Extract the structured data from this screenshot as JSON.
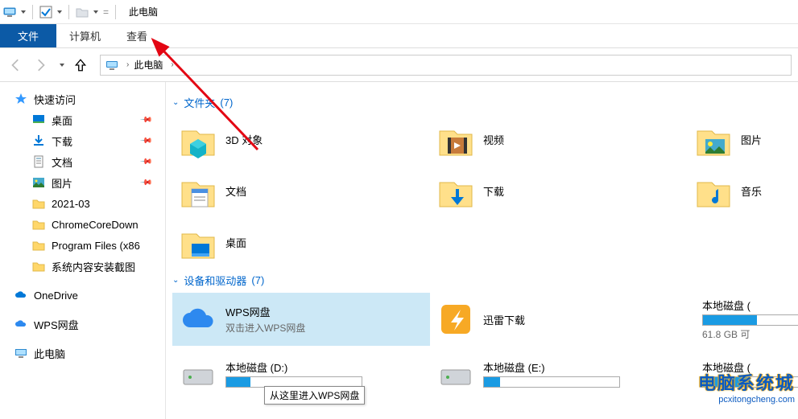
{
  "window_title": "此电脑",
  "ribbon": {
    "file": "文件",
    "computer": "计算机",
    "view": "查看"
  },
  "breadcrumb": {
    "label": "此电脑"
  },
  "sidebar": {
    "quick_access": "快速访问",
    "items": [
      {
        "label": "桌面"
      },
      {
        "label": "下载"
      },
      {
        "label": "文档"
      },
      {
        "label": "图片"
      },
      {
        "label": "2021-03"
      },
      {
        "label": "ChromeCoreDown"
      },
      {
        "label": "Program Files (x86"
      },
      {
        "label": "系统内容安装截图"
      }
    ],
    "onedrive": "OneDrive",
    "wps": "WPS网盘",
    "this_pc": "此电脑"
  },
  "section_folders": {
    "label": "文件夹",
    "count": "(7)"
  },
  "folders": [
    {
      "label": "3D 对象"
    },
    {
      "label": "视频"
    },
    {
      "label": "图片"
    },
    {
      "label": "文档"
    },
    {
      "label": "下载"
    },
    {
      "label": "音乐"
    },
    {
      "label": "桌面"
    }
  ],
  "section_devices": {
    "label": "设备和驱动器",
    "count": "(7)"
  },
  "devices": [
    {
      "label": "WPS网盘",
      "sub": "双击进入WPS网盘"
    },
    {
      "label": "迅雷下载",
      "sub": ""
    },
    {
      "label": "本地磁盘 (",
      "cap": "61.8 GB 可"
    },
    {
      "label": "本地磁盘 (D:)",
      "cap": ""
    },
    {
      "label": "本地磁盘 (E:)",
      "cap": ""
    },
    {
      "label": "本地磁盘 (",
      "cap": ""
    }
  ],
  "tooltip": "从这里进入WPS网盘",
  "watermark": {
    "cn": "电脑系统城",
    "url": "pcxitongcheng.com"
  }
}
